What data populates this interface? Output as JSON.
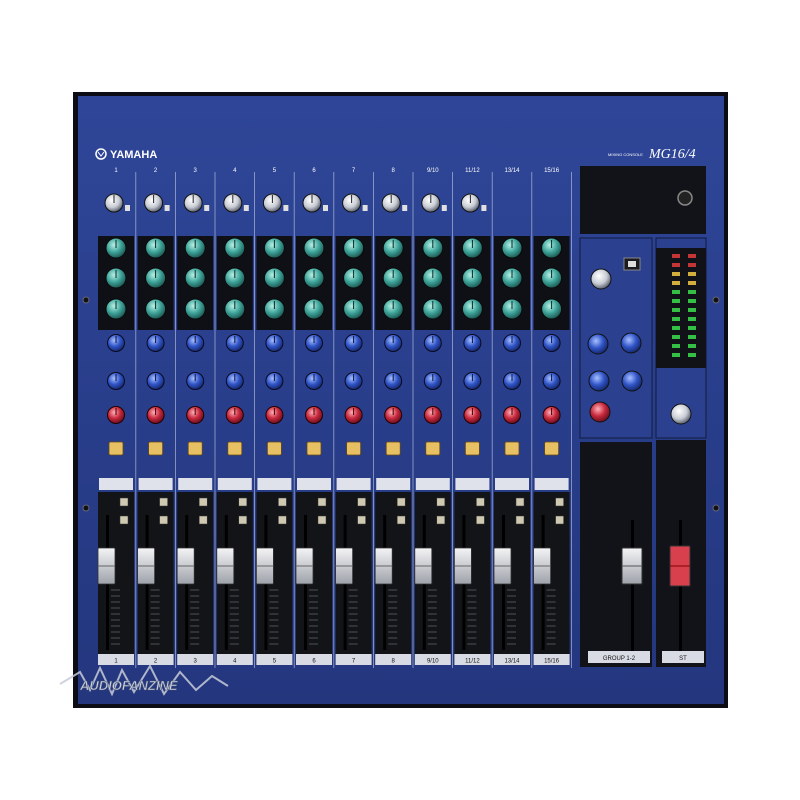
{
  "brand": {
    "name": "YAMAHA",
    "model": "MG16/4",
    "subtitle": "MIXING CONSOLE"
  },
  "watermark": {
    "text": "AUDIOFANZINE"
  },
  "channels": [
    {
      "top": "1",
      "bottom": "1"
    },
    {
      "top": "2",
      "bottom": "2"
    },
    {
      "top": "3",
      "bottom": "3"
    },
    {
      "top": "4",
      "bottom": "4"
    },
    {
      "top": "5",
      "bottom": "5"
    },
    {
      "top": "6",
      "bottom": "6"
    },
    {
      "top": "7",
      "bottom": "7"
    },
    {
      "top": "8",
      "bottom": "8"
    },
    {
      "top": "9/10",
      "bottom": "9/10"
    },
    {
      "top": "11/12",
      "bottom": "11/12"
    },
    {
      "top": "13/14",
      "bottom": "13/14"
    },
    {
      "top": "15/16",
      "bottom": "15/16"
    }
  ],
  "master": {
    "group_label": "GROUP 1-2",
    "stereo_label": "ST"
  },
  "colors": {
    "panel": "#2a3f8c",
    "panel_dark": "#1c2b66",
    "eq_knob": "#3fa59b",
    "aux_knob": "#3155c8",
    "pan_knob": "#c8283c",
    "on_button": "#e8c064",
    "meter_green": "#39d34a",
    "group_fader_cap": "#d0d0d8",
    "stereo_fader_cap": "#d8404e"
  }
}
